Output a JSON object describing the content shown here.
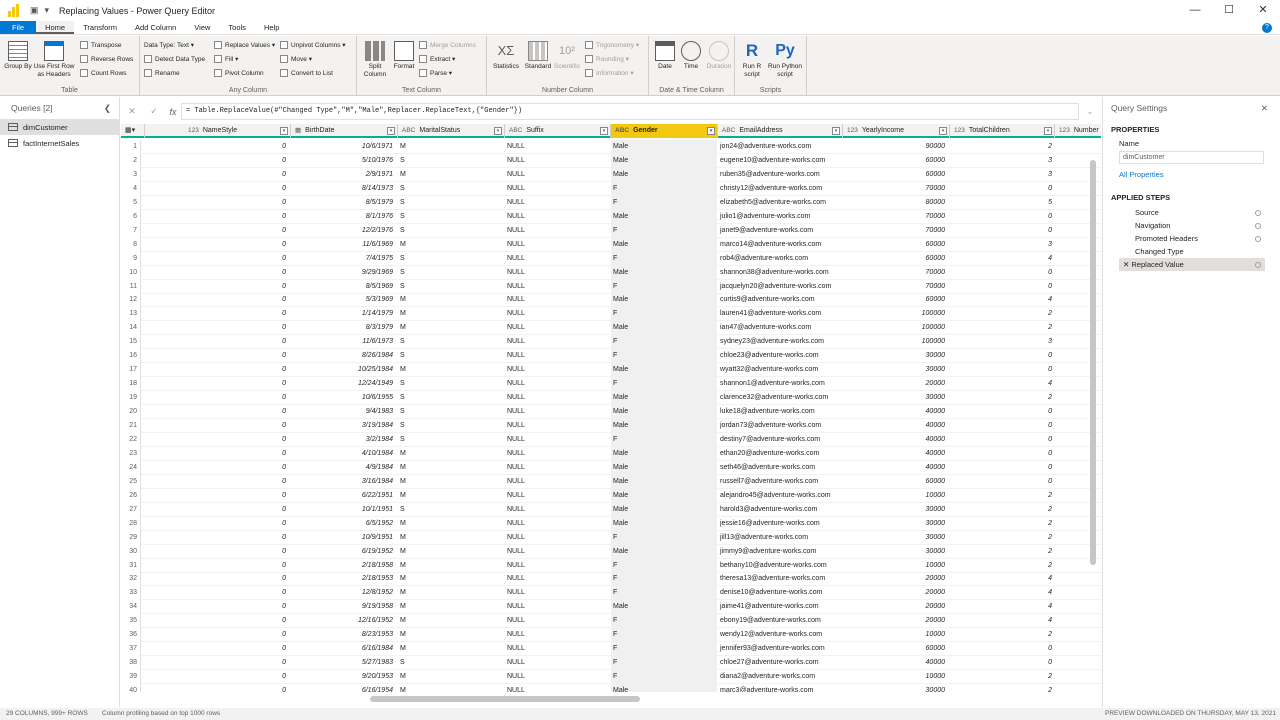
{
  "window": {
    "title": "Replacing Values - Power Query Editor",
    "controls": [
      "—",
      "☐",
      "✕"
    ]
  },
  "tabs": [
    "File",
    "Home",
    "Transform",
    "Add Column",
    "View",
    "Tools",
    "Help"
  ],
  "ribbon": {
    "table_group": {
      "label": "Table",
      "group_by": "Group By",
      "use_first_row": "Use First Row as Headers",
      "transpose": "Transpose",
      "reverse_rows": "Reverse Rows",
      "count_rows": "Count Rows"
    },
    "any_column_group": {
      "label": "Any Column",
      "data_type": "Data Type: Text",
      "detect_data_type": "Detect Data Type",
      "rename": "Rename",
      "replace_values": "Replace Values",
      "fill": "Fill",
      "pivot_column": "Pivot Column",
      "unpivot_columns": "Unpivot Columns",
      "move": "Move",
      "convert_to_list": "Convert to List"
    },
    "text_column_group": {
      "label": "Text Column",
      "split_column": "Split Column",
      "format": "Format",
      "merge_columns": "Merge Columns",
      "extract": "Extract",
      "parse": "Parse"
    },
    "number_column_group": {
      "label": "Number Column",
      "statistics": "Statistics",
      "standard": "Standard",
      "scientific": "Scientific",
      "trigonometry": "Trigonometry",
      "rounding": "Rounding",
      "information": "Information"
    },
    "date_time_group": {
      "label": "Date & Time Column",
      "date": "Date",
      "time": "Time",
      "duration": "Duration"
    },
    "scripts_group": {
      "label": "Scripts",
      "run_r": "Run R script",
      "run_python": "Run Python script"
    }
  },
  "queries": {
    "header": "Queries [2]",
    "items": [
      "dimCustomer",
      "factInternetSales"
    ]
  },
  "formula": "= Table.ReplaceValue(#\"Changed Type\",\"M\",\"Male\",Replacer.ReplaceText,{\"Gender\"})",
  "columns": [
    {
      "name": "NameStyle",
      "type": "123"
    },
    {
      "name": "BirthDate",
      "type": "▦"
    },
    {
      "name": "MaritalStatus",
      "type": "ABC"
    },
    {
      "name": "Suffix",
      "type": "ABC"
    },
    {
      "name": "Gender",
      "type": "ABC"
    },
    {
      "name": "EmailAddress",
      "type": "ABC"
    },
    {
      "name": "YearlyIncome",
      "type": "123"
    },
    {
      "name": "TotalChildren",
      "type": "123"
    },
    {
      "name": "Number",
      "type": "123"
    }
  ],
  "rows": [
    [
      "1",
      "0",
      "10/6/1971",
      "M",
      "NULL",
      "Male",
      "jon24@adventure-works.com",
      "90000",
      "2"
    ],
    [
      "2",
      "0",
      "5/10/1976",
      "S",
      "NULL",
      "Male",
      "eugene10@adventure-works.com",
      "60000",
      "3"
    ],
    [
      "3",
      "0",
      "2/9/1971",
      "M",
      "NULL",
      "Male",
      "ruben35@adventure-works.com",
      "60000",
      "3"
    ],
    [
      "4",
      "0",
      "8/14/1973",
      "S",
      "NULL",
      "F",
      "christy12@adventure-works.com",
      "70000",
      "0"
    ],
    [
      "5",
      "0",
      "8/5/1979",
      "S",
      "NULL",
      "F",
      "elizabeth5@adventure-works.com",
      "80000",
      "5"
    ],
    [
      "6",
      "0",
      "8/1/1976",
      "S",
      "NULL",
      "Male",
      "julio1@adventure-works.com",
      "70000",
      "0"
    ],
    [
      "7",
      "0",
      "12/2/1976",
      "S",
      "NULL",
      "F",
      "janet9@adventure-works.com",
      "70000",
      "0"
    ],
    [
      "8",
      "0",
      "11/6/1969",
      "M",
      "NULL",
      "Male",
      "marco14@adventure-works.com",
      "60000",
      "3"
    ],
    [
      "9",
      "0",
      "7/4/1975",
      "S",
      "NULL",
      "F",
      "rob4@adventure-works.com",
      "60000",
      "4"
    ],
    [
      "10",
      "0",
      "9/29/1969",
      "S",
      "NULL",
      "Male",
      "shannon38@adventure-works.com",
      "70000",
      "0"
    ],
    [
      "11",
      "0",
      "8/5/1969",
      "S",
      "NULL",
      "F",
      "jacquelyn20@adventure-works.com",
      "70000",
      "0"
    ],
    [
      "12",
      "0",
      "5/3/1969",
      "M",
      "NULL",
      "Male",
      "curtis9@adventure-works.com",
      "60000",
      "4"
    ],
    [
      "13",
      "0",
      "1/14/1979",
      "M",
      "NULL",
      "F",
      "lauren41@adventure-works.com",
      "100000",
      "2"
    ],
    [
      "14",
      "0",
      "8/3/1979",
      "M",
      "NULL",
      "Male",
      "ian47@adventure-works.com",
      "100000",
      "2"
    ],
    [
      "15",
      "0",
      "11/6/1973",
      "S",
      "NULL",
      "F",
      "sydney23@adventure-works.com",
      "100000",
      "3"
    ],
    [
      "16",
      "0",
      "8/26/1984",
      "S",
      "NULL",
      "F",
      "chloe23@adventure-works.com",
      "30000",
      "0"
    ],
    [
      "17",
      "0",
      "10/25/1984",
      "M",
      "NULL",
      "Male",
      "wyatt32@adventure-works.com",
      "30000",
      "0"
    ],
    [
      "18",
      "0",
      "12/24/1949",
      "S",
      "NULL",
      "F",
      "shannon1@adventure-works.com",
      "20000",
      "4"
    ],
    [
      "19",
      "0",
      "10/6/1955",
      "S",
      "NULL",
      "Male",
      "clarence32@adventure-works.com",
      "30000",
      "2"
    ],
    [
      "20",
      "0",
      "9/4/1983",
      "S",
      "NULL",
      "Male",
      "luke18@adventure-works.com",
      "40000",
      "0"
    ],
    [
      "21",
      "0",
      "3/19/1984",
      "S",
      "NULL",
      "Male",
      "jordan73@adventure-works.com",
      "40000",
      "0"
    ],
    [
      "22",
      "0",
      "3/2/1984",
      "S",
      "NULL",
      "F",
      "destiny7@adventure-works.com",
      "40000",
      "0"
    ],
    [
      "23",
      "0",
      "4/10/1984",
      "M",
      "NULL",
      "Male",
      "ethan20@adventure-works.com",
      "40000",
      "0"
    ],
    [
      "24",
      "0",
      "4/9/1984",
      "M",
      "NULL",
      "Male",
      "seth46@adventure-works.com",
      "40000",
      "0"
    ],
    [
      "25",
      "0",
      "3/16/1984",
      "M",
      "NULL",
      "Male",
      "russell7@adventure-works.com",
      "60000",
      "0"
    ],
    [
      "26",
      "0",
      "6/22/1951",
      "M",
      "NULL",
      "Male",
      "alejandro45@adventure-works.com",
      "10000",
      "2"
    ],
    [
      "27",
      "0",
      "10/1/1951",
      "S",
      "NULL",
      "Male",
      "harold3@adventure-works.com",
      "30000",
      "2"
    ],
    [
      "28",
      "0",
      "6/5/1952",
      "M",
      "NULL",
      "Male",
      "jessie16@adventure-works.com",
      "30000",
      "2"
    ],
    [
      "29",
      "0",
      "10/9/1951",
      "M",
      "NULL",
      "F",
      "jill13@adventure-works.com",
      "30000",
      "2"
    ],
    [
      "30",
      "0",
      "6/19/1952",
      "M",
      "NULL",
      "Male",
      "jimmy9@adventure-works.com",
      "30000",
      "2"
    ],
    [
      "31",
      "0",
      "2/18/1958",
      "M",
      "NULL",
      "F",
      "bethany10@adventure-works.com",
      "10000",
      "2"
    ],
    [
      "32",
      "0",
      "2/18/1953",
      "M",
      "NULL",
      "F",
      "theresa13@adventure-works.com",
      "20000",
      "4"
    ],
    [
      "33",
      "0",
      "12/8/1952",
      "M",
      "NULL",
      "F",
      "denise10@adventure-works.com",
      "20000",
      "4"
    ],
    [
      "34",
      "0",
      "9/19/1958",
      "M",
      "NULL",
      "Male",
      "jaime41@adventure-works.com",
      "20000",
      "4"
    ],
    [
      "35",
      "0",
      "12/16/1952",
      "M",
      "NULL",
      "F",
      "ebony19@adventure-works.com",
      "20000",
      "4"
    ],
    [
      "36",
      "0",
      "8/23/1953",
      "M",
      "NULL",
      "F",
      "wendy12@adventure-works.com",
      "10000",
      "2"
    ],
    [
      "37",
      "0",
      "6/16/1984",
      "M",
      "NULL",
      "F",
      "jennifer93@adventure-works.com",
      "60000",
      "0"
    ],
    [
      "38",
      "0",
      "5/27/1983",
      "S",
      "NULL",
      "F",
      "chloe27@adventure-works.com",
      "40000",
      "0"
    ],
    [
      "39",
      "0",
      "9/20/1953",
      "M",
      "NULL",
      "F",
      "diana2@adventure-works.com",
      "10000",
      "2"
    ],
    [
      "40",
      "0",
      "6/16/1954",
      "M",
      "NULL",
      "Male",
      "marc3@adventure-works.com",
      "30000",
      "2"
    ]
  ],
  "query_settings": {
    "header": "Query Settings",
    "properties_label": "PROPERTIES",
    "name_label": "Name",
    "name_value": "dimCustomer",
    "all_properties": "All Properties",
    "applied_steps_label": "APPLIED STEPS",
    "steps": [
      "Source",
      "Navigation",
      "Promoted Headers",
      "Changed Type",
      "Replaced Value"
    ]
  },
  "status": {
    "left": "29 COLUMNS, 999+ ROWS",
    "profiling": "Column profiling based on top 1000 rows",
    "right": "PREVIEW DOWNLOADED ON THURSDAY, MAY 13, 2021"
  },
  "colors": {
    "accent": "#0078d4",
    "highlight_header": "#f2c811",
    "profile_bar": "#00b294"
  },
  "icons": [
    "powerbi-logo-icon",
    "save-icon",
    "undo-icon",
    "help-icon",
    "collapse-icon",
    "close-icon",
    "table-icon",
    "gear-icon",
    "filter-dropdown-icon"
  ]
}
